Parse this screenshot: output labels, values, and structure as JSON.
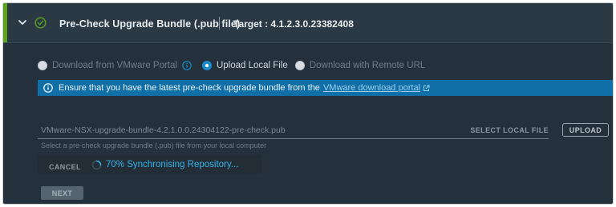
{
  "header": {
    "title": "Pre-Check Upgrade Bundle (.pub file)",
    "target": "Target : 4.1.2.3.0.23382408"
  },
  "source_options": [
    {
      "label": "Download from VMware Portal",
      "selected": false,
      "enabled": false
    },
    {
      "label": "Upload Local File",
      "selected": true,
      "enabled": true
    },
    {
      "label": "Download with Remote URL",
      "selected": false,
      "enabled": true
    }
  ],
  "info_banner": {
    "message": "Ensure that you have the latest pre-check upgrade bundle from the",
    "link_text": "VMware download portal"
  },
  "file_input": {
    "value": "VMware-NSX-upgrade-bundle-4.2.1.0.0.24304122-pre-check.pub",
    "select_label": "SELECT LOCAL FILE",
    "helper": "Select a pre-check upgrade bundle (.pub) file from your local computer"
  },
  "upload_label": "UPLOAD",
  "cancel_label": "CANCEL",
  "sync_status": "70% Synchronising Repository...",
  "next_label": "NEXT",
  "colors": {
    "accent_green": "#5aa220",
    "banner_blue": "#0f6fa6",
    "spinner_blue": "#35b3e8"
  }
}
